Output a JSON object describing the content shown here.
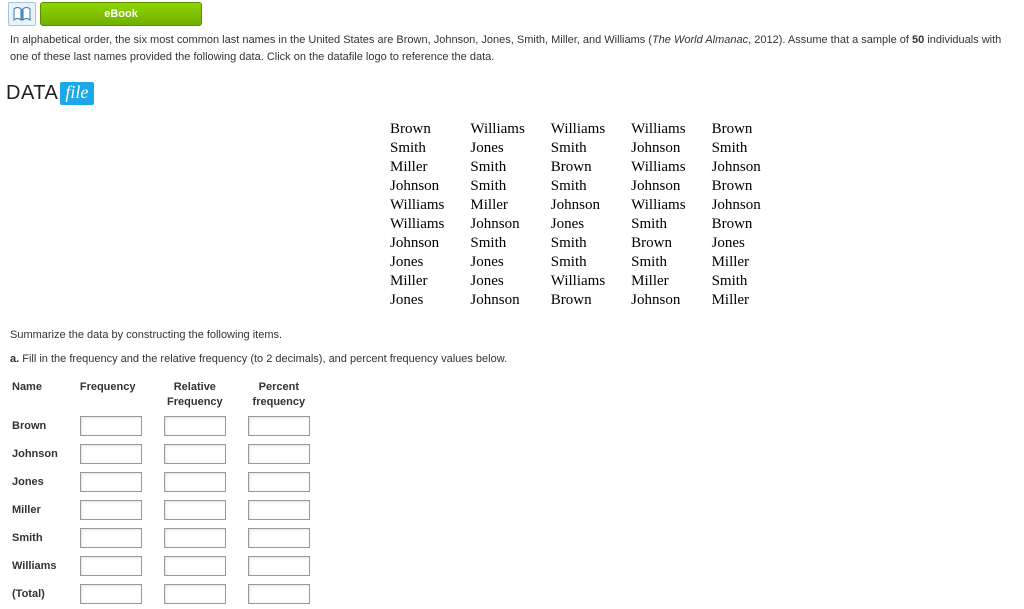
{
  "ebook": {
    "label": "eBook",
    "icon": "open-book"
  },
  "intro": {
    "pre": "In alphabetical order, the six most common last names in the United States are Brown, Johnson, Jones, Smith, Miller, and Williams (",
    "source": "The World Almanac",
    "post_source": ", 2012). Assume that a sample of ",
    "n": "50",
    "post_n": " individuals with one of these last names provided the following data. Click on the datafile logo to reference the data."
  },
  "datafile": {
    "data": "DATA",
    "file": "file"
  },
  "grid": [
    [
      "Brown",
      "Williams",
      "Williams",
      "Williams",
      "Brown"
    ],
    [
      "Smith",
      "Jones",
      "Smith",
      "Johnson",
      "Smith"
    ],
    [
      "Miller",
      "Smith",
      "Brown",
      "Williams",
      "Johnson"
    ],
    [
      "Johnson",
      "Smith",
      "Smith",
      "Johnson",
      "Brown"
    ],
    [
      "Williams",
      "Miller",
      "Johnson",
      "Williams",
      "Johnson"
    ],
    [
      "Williams",
      "Johnson",
      "Jones",
      "Smith",
      "Brown"
    ],
    [
      "Johnson",
      "Smith",
      "Smith",
      "Brown",
      "Jones"
    ],
    [
      "Jones",
      "Jones",
      "Smith",
      "Smith",
      "Miller"
    ],
    [
      "Miller",
      "Jones",
      "Williams",
      "Miller",
      "Smith"
    ],
    [
      "Jones",
      "Johnson",
      "Brown",
      "Johnson",
      "Miller"
    ]
  ],
  "summarize": "Summarize the data by constructing the following items.",
  "part_a": {
    "label": "a.",
    "text": " Fill in the frequency and the relative frequency (to 2 decimals), and percent frequency values below."
  },
  "freq": {
    "headers": {
      "name": "Name",
      "freq": "Frequency",
      "rel1": "Relative",
      "rel2": "Frequency",
      "pct1": "Percent",
      "pct2": "frequency"
    },
    "rows": [
      "Brown",
      "Johnson",
      "Jones",
      "Miller",
      "Smith",
      "Williams",
      "(Total)"
    ]
  }
}
